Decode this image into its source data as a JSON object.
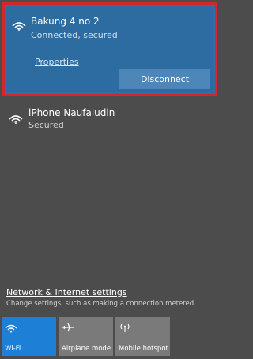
{
  "networks": [
    {
      "name": "Bakung 4 no 2",
      "status": "Connected, secured",
      "properties_label": "Properties",
      "disconnect_label": "Disconnect",
      "icon": "wifi-icon"
    },
    {
      "name": "iPhone Naufaludin",
      "status": "Secured",
      "icon": "wifi-icon"
    }
  ],
  "settings": {
    "link_label": "Network & Internet settings",
    "description": "Change settings, such as making a connection metered."
  },
  "quick_actions": [
    {
      "label": "Wi-Fi",
      "icon": "wifi-icon",
      "active": true
    },
    {
      "label": "Airplane mode",
      "icon": "airplane-icon",
      "active": false
    },
    {
      "label": "Mobile hotspot",
      "icon": "hotspot-icon",
      "active": false
    }
  ],
  "colors": {
    "background": "#4c4c4c",
    "selected": "#2d6ca0",
    "highlight_border": "#d7262b",
    "active_tile": "#1e7fd6",
    "tile": "#7a7a7a"
  }
}
